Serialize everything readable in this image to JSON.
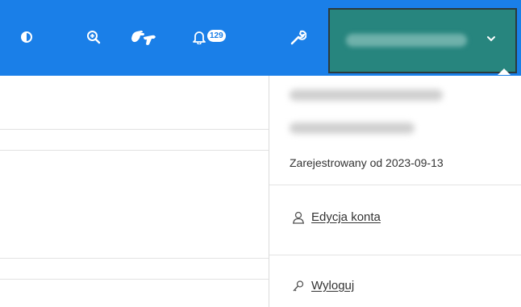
{
  "toolbar": {
    "contrast_icon": "half-circle-icon",
    "zoom_icon": "zoom-in-icon",
    "sign_language_icon": "sign-language-icon",
    "notifications_icon": "bell-icon",
    "notifications_count": "129",
    "settings_icon": "wrench-icon"
  },
  "account": {
    "chevron_icon": "chevron-down-icon",
    "accent_color": "#27857e"
  },
  "dropdown": {
    "registered_text": "Zarejestrowany od 2023-09-13",
    "edit_account_label": " Edycja konta",
    "edit_account_icon": "user-icon",
    "logout_label": " Wyloguj",
    "logout_icon": "key-icon"
  },
  "colors": {
    "topbar": "#1a7fe8",
    "text": "#333333"
  }
}
